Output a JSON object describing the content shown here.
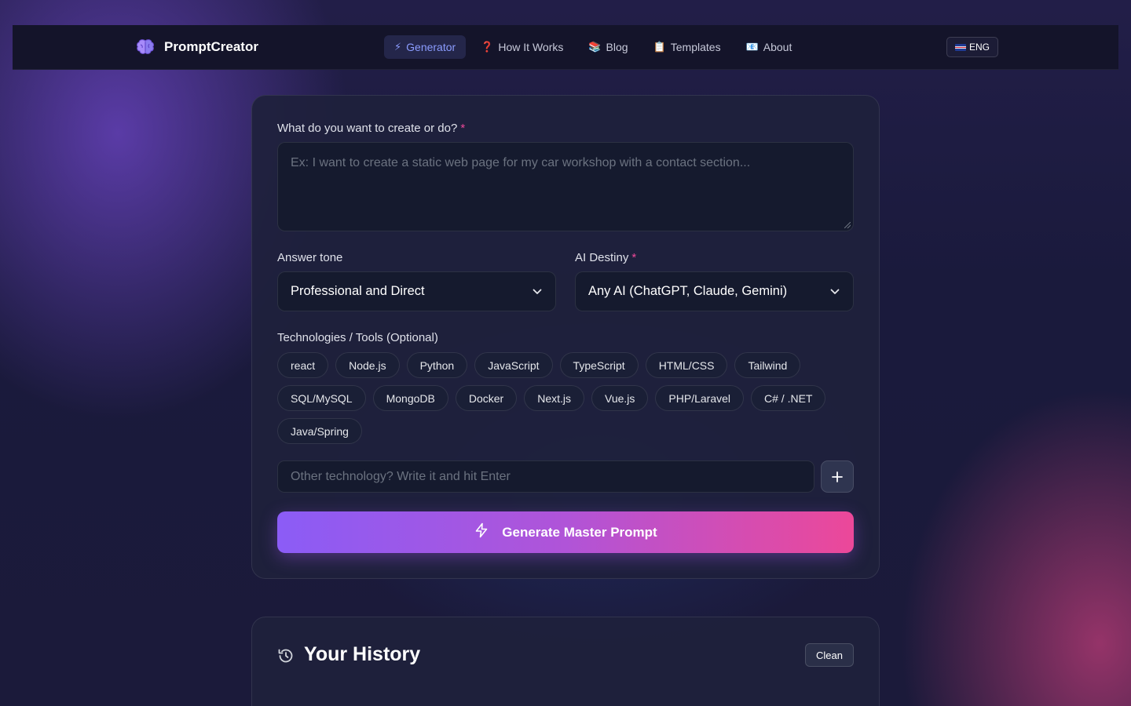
{
  "app": {
    "name": "PromptCreator",
    "logo_icon": "brain-icon"
  },
  "nav": {
    "items": [
      {
        "emoji": "⚡",
        "label": "Generator",
        "active": true
      },
      {
        "emoji": "❓",
        "label": "How It Works"
      },
      {
        "emoji": "📚",
        "label": "Blog"
      },
      {
        "emoji": "📋",
        "label": "Templates"
      },
      {
        "emoji": "📧",
        "label": "About"
      }
    ],
    "language": "ENG"
  },
  "form": {
    "description_label": "What do you want to create or do?",
    "description_required": "*",
    "description_placeholder": "Ex: I want to create a static web page for my car workshop with a contact section...",
    "tone_label": "Answer tone",
    "tone_value": "Professional and Direct",
    "destiny_label": "AI Destiny",
    "destiny_required": "*",
    "destiny_value": "Any AI (ChatGPT, Claude, Gemini)",
    "tech_label": "Technologies / Tools (Optional)",
    "tech_rows": [
      [
        "react",
        "Node.js",
        "Python",
        "JavaScript",
        "TypeScript",
        "HTML/CSS",
        "Tailwind"
      ],
      [
        "SQL/MySQL",
        "MongoDB",
        "Docker",
        "Next.js",
        "Vue.js",
        "PHP/Laravel",
        "C# / .NET"
      ],
      [
        "Java/Spring"
      ]
    ],
    "other_placeholder": "Other technology? Write it and hit Enter",
    "add_symbol": "+",
    "generate_label": "Generate Master Prompt"
  },
  "history": {
    "title": "Your History",
    "clean_label": "Clean"
  },
  "colors": {
    "accent_purple": "#8b5cf6",
    "accent_pink": "#ec4899",
    "nav_active": "#8b9cff"
  }
}
